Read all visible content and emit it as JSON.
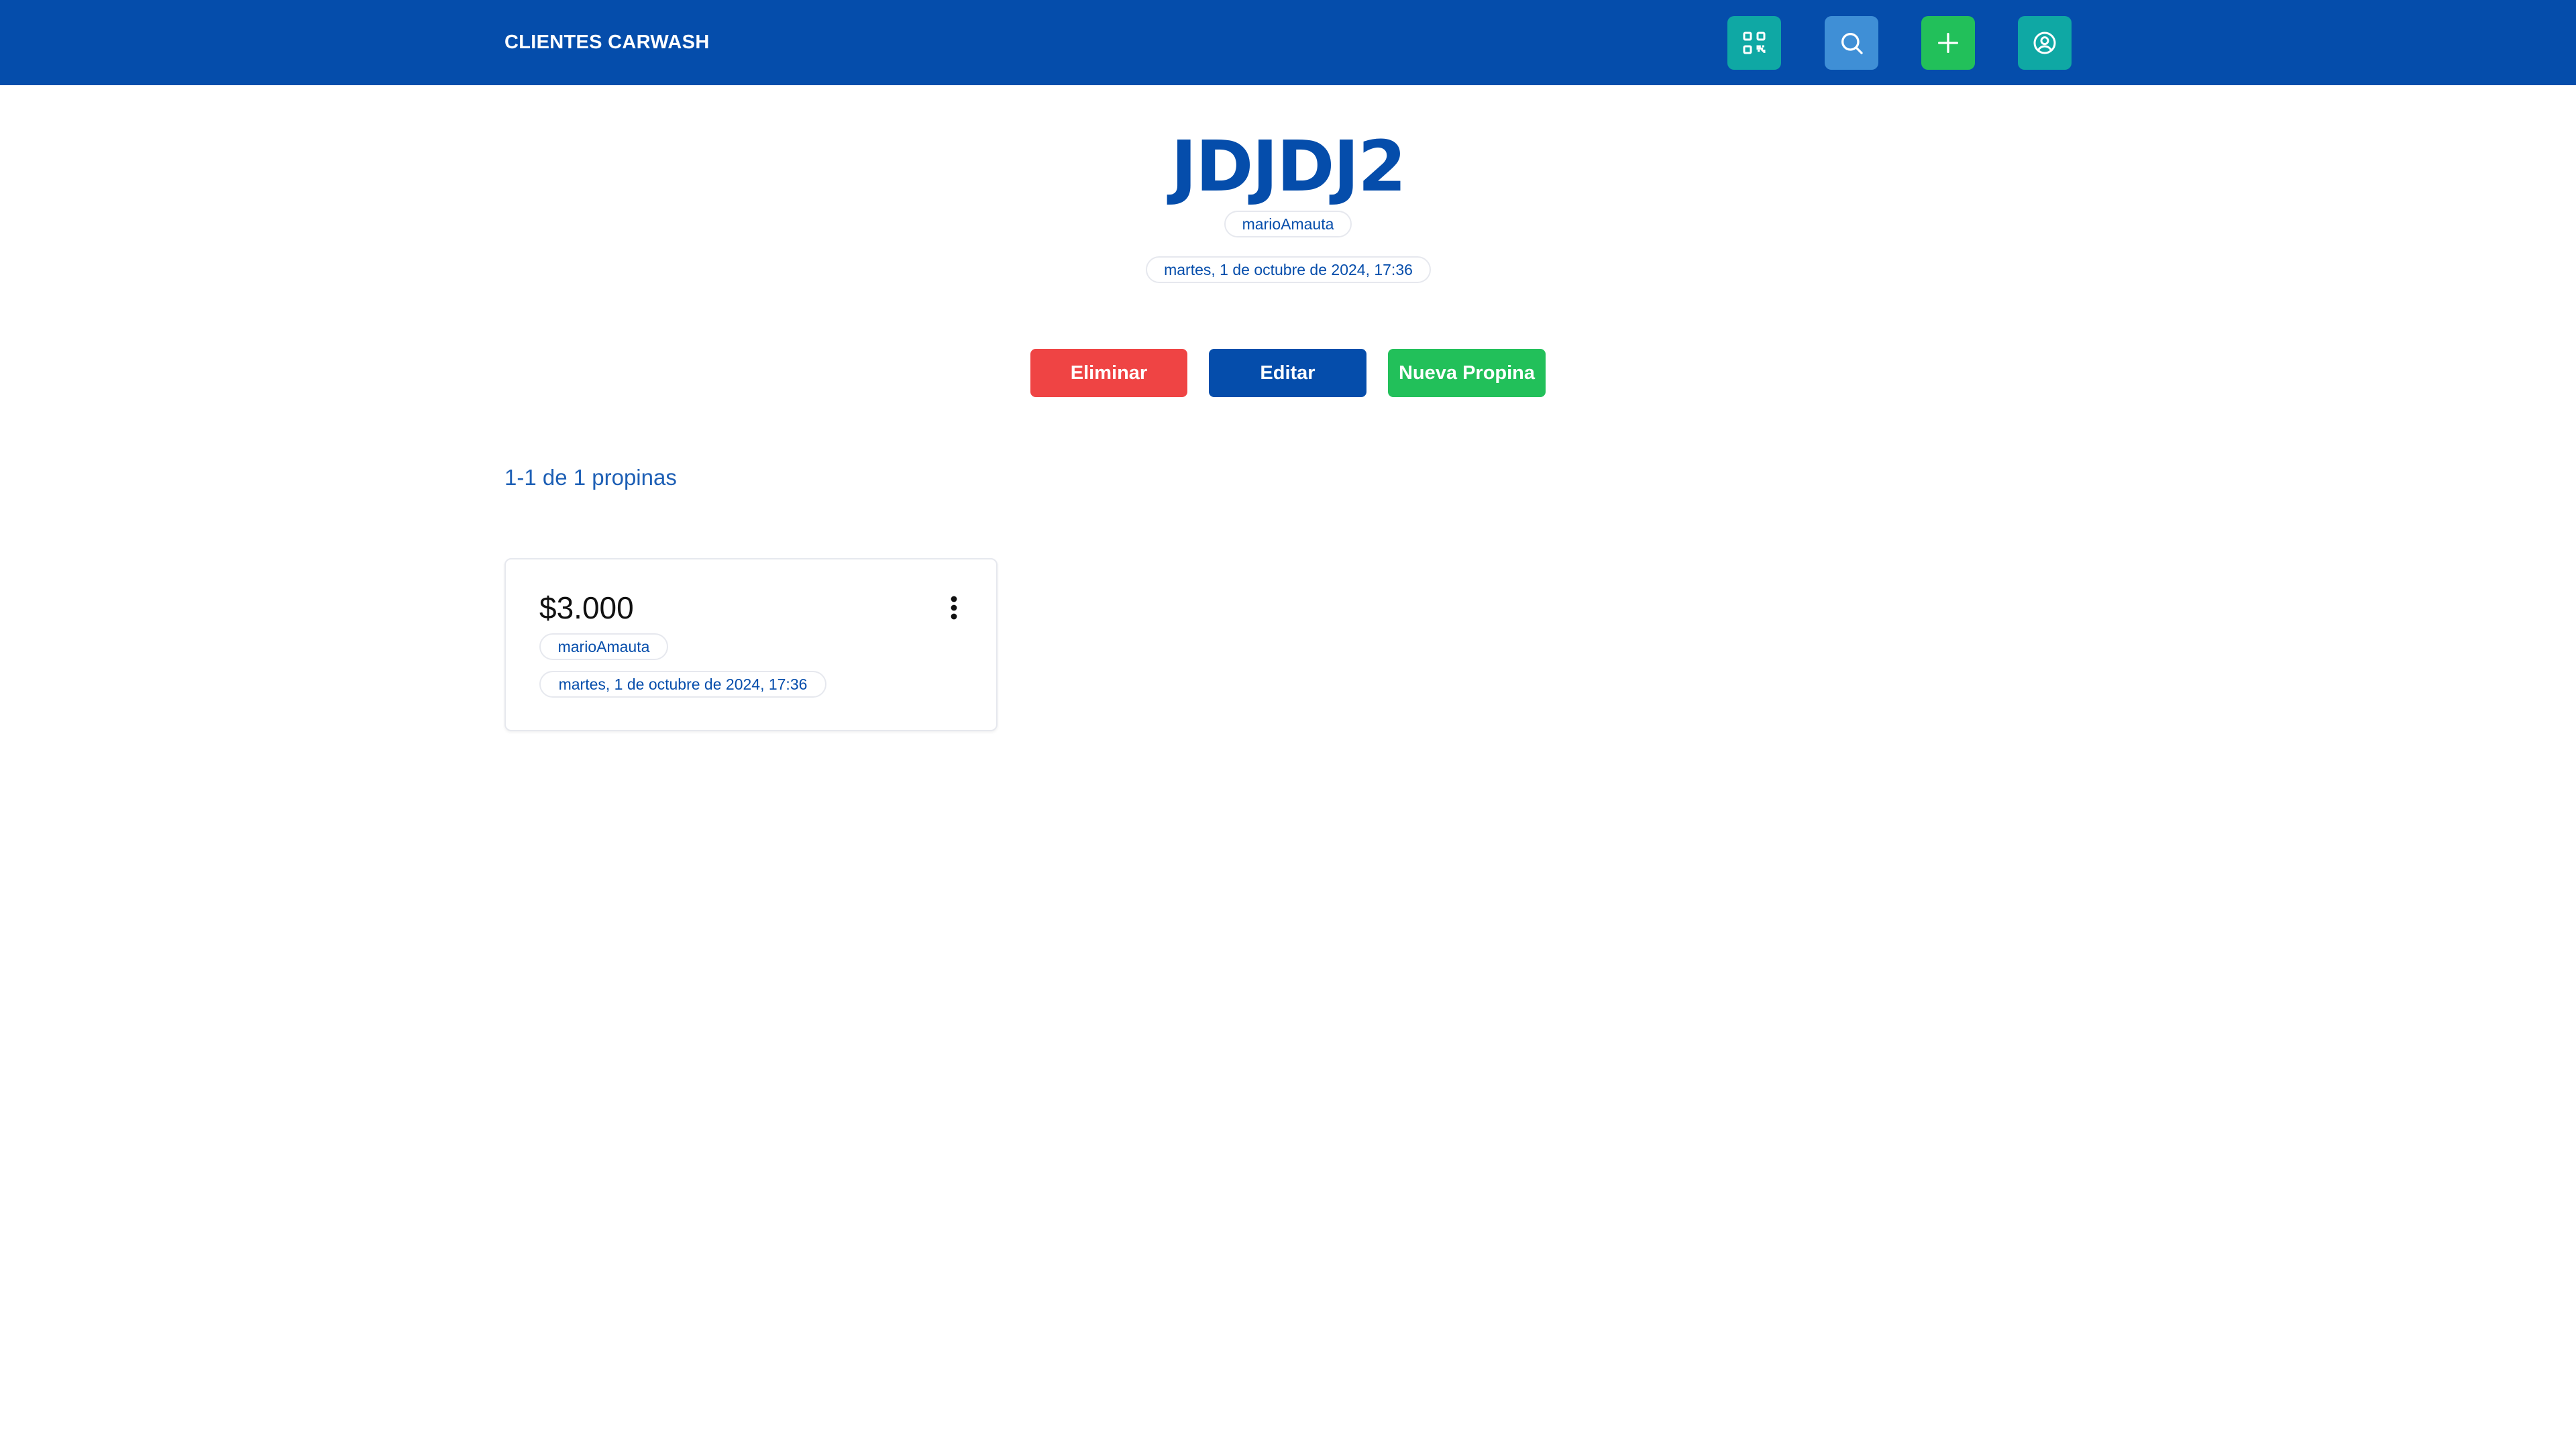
{
  "header": {
    "brand": "CLIENTES CARWASH",
    "colors": {
      "bar": "#054dab",
      "qr": "#0fa8a4",
      "search": "#3f8fd6",
      "add": "#22c05a",
      "user": "#0fa8a4"
    },
    "icons": [
      "qr-code-icon",
      "search-icon",
      "plus-icon",
      "user-circle-icon"
    ]
  },
  "client": {
    "name": "JDJDJ2",
    "user": "marioAmauta",
    "date": "martes, 1 de octubre de 2024, 17:36"
  },
  "actions": {
    "delete_label": "Eliminar",
    "edit_label": "Editar",
    "new_label": "Nueva Propina",
    "colors": {
      "delete": "#ef4444",
      "edit": "#054dab",
      "new": "#22c05a"
    }
  },
  "list": {
    "count_text": "1-1 de 1 propinas",
    "items": [
      {
        "amount": "$3.000",
        "user": "marioAmauta",
        "date": "martes, 1 de octubre de 2024, 17:36",
        "menu_icon": "more-vertical-icon"
      }
    ]
  }
}
